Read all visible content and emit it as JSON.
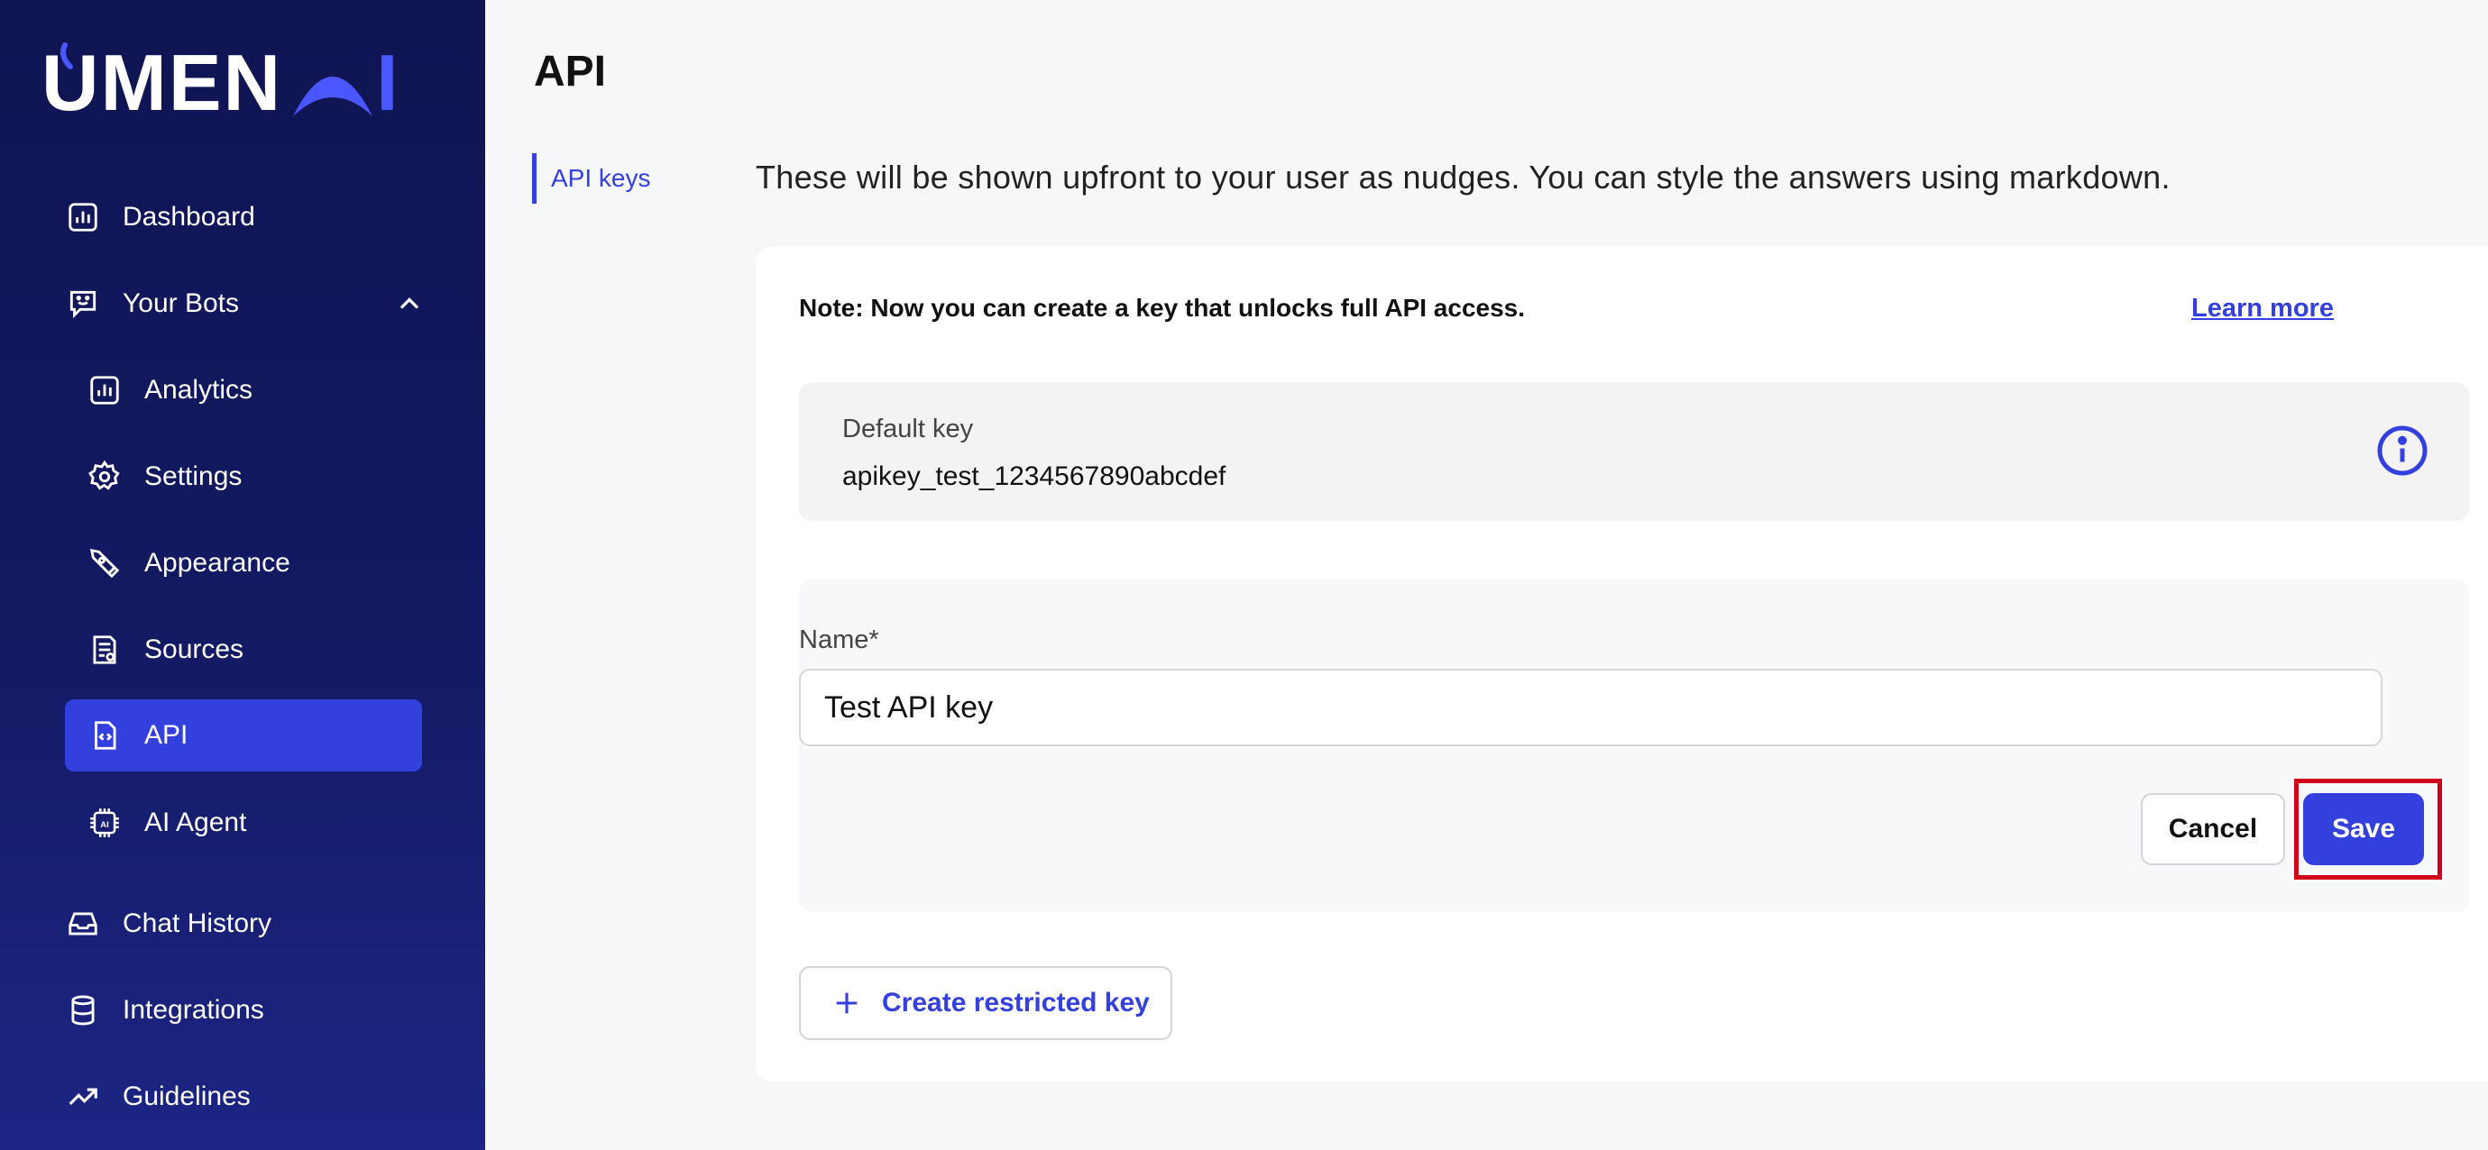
{
  "brand": {
    "logo_text": "UMEN",
    "logo_suffix": "I",
    "accent": "#3340dd",
    "sidebar_bg": "#131a62"
  },
  "sidebar": {
    "items": [
      {
        "label": "Dashboard",
        "icon": "chart-icon"
      },
      {
        "label": "Your Bots",
        "icon": "bot-icon",
        "expanded": true
      },
      {
        "label": "Analytics",
        "icon": "chart-icon"
      },
      {
        "label": "Settings",
        "icon": "gear-icon"
      },
      {
        "label": "Appearance",
        "icon": "pen-tool-icon"
      },
      {
        "label": "Sources",
        "icon": "document-icon"
      },
      {
        "label": "API",
        "icon": "code-file-icon",
        "active": true
      },
      {
        "label": "AI Agent",
        "icon": "chip-icon"
      },
      {
        "label": "Chat History",
        "icon": "inbox-icon"
      },
      {
        "label": "Integrations",
        "icon": "database-icon"
      },
      {
        "label": "Guidelines",
        "icon": "trend-up-icon"
      }
    ]
  },
  "main": {
    "title": "API",
    "subnav": {
      "label": "API keys"
    },
    "intro": "These will be shown upfront to your user as nudges. You can style the answers using markdown.",
    "note": "Note: Now you can create a key that unlocks full API access.",
    "learn_more": "Learn more",
    "default_key": {
      "label": "Default key",
      "value": "apikey_test_1234567890abcdef",
      "icon": "info-icon"
    },
    "form": {
      "name_label": "Name*",
      "name_value": "Test API key",
      "cancel_label": "Cancel",
      "save_label": "Save"
    },
    "create_restricted_label": "Create restricted key"
  }
}
